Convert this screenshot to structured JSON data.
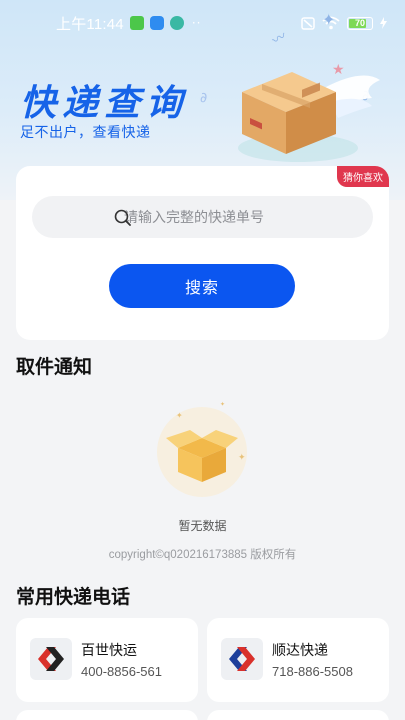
{
  "status_bar": {
    "time": "上午11:44",
    "dots": "··",
    "battery": "70"
  },
  "hero": {
    "title": "快递查询",
    "subtitle": "足不出户，查看快递"
  },
  "search": {
    "badge": "猜你喜欢",
    "placeholder": "请输入完整的快递单号",
    "button_label": "搜索"
  },
  "pickup": {
    "section_title": "取件通知",
    "empty_text": "暂无数据",
    "copyright": "copyright©q020216173885 版权所有"
  },
  "couriers": {
    "section_title": "常用快递电话",
    "items": [
      {
        "name": "百世快运",
        "phone": "400-8856-561"
      },
      {
        "name": "顺达快递",
        "phone": "718-886-5508"
      }
    ]
  },
  "colors": {
    "accent": "#0b56f0",
    "title_blue": "#1663e8",
    "badge_red": "#e0374e"
  }
}
